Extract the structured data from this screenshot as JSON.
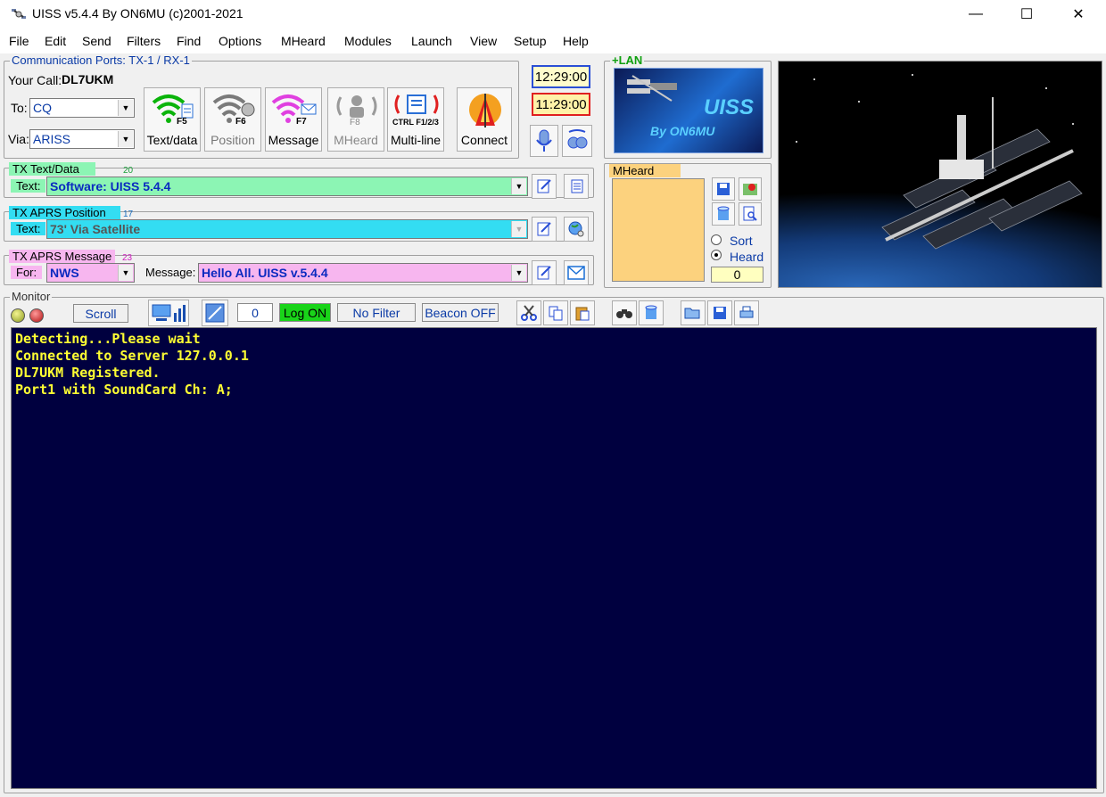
{
  "window": {
    "title": "UISS v5.4.4 By ON6MU (c)2001-2021",
    "minimize": "—",
    "maximize": "☐",
    "close": "✕"
  },
  "menu": [
    "File",
    "Edit",
    "Send",
    "Filters",
    "Find",
    "Options",
    "MHeard",
    "Modules",
    "Launch",
    "View",
    "Setup",
    "Help"
  ],
  "comm": {
    "group_title": "Communication Ports: TX-1 / RX-1",
    "your_call_label": "Your Call:",
    "your_call": "DL7UKM",
    "to_label": "To:",
    "to_value": "CQ",
    "via_label": "Via:",
    "via_value": "ARISS"
  },
  "buttons": {
    "text_data": {
      "label": "Text/data",
      "fkey": "F5"
    },
    "position": {
      "label": "Position",
      "fkey": "F6"
    },
    "message": {
      "label": "Message",
      "fkey": "F7"
    },
    "mheard": {
      "label": "MHeard",
      "fkey": "F8"
    },
    "multiline": {
      "label": "Multi-line",
      "fkey": "CTRL F1/2/3"
    },
    "connect": {
      "label": "Connect"
    }
  },
  "clocks": {
    "utc": "12:29:00",
    "local": "11:29:00"
  },
  "lan": {
    "label": "+LAN",
    "logo_title": "UISS",
    "logo_sub": "By ON6MU"
  },
  "tx_text": {
    "title": "TX Text/Data",
    "count": "20",
    "text_label": "Text:",
    "value": "Software: UISS 5.4.4"
  },
  "tx_pos": {
    "title": "TX APRS Position",
    "count": "17",
    "text_label": "Text:",
    "value": "73' Via Satellite"
  },
  "tx_msg": {
    "title": "TX APRS Message",
    "count": "23",
    "for_label": "For:",
    "for_value": "NWS",
    "message_label": "Message:",
    "message_value": "Hello All. UISS v.5.4.4"
  },
  "mheard_panel": {
    "title": "MHeard",
    "sort_label": "Sort",
    "heard_label": "Heard",
    "count": "0"
  },
  "monitor": {
    "title": "Monitor",
    "scroll": "Scroll",
    "counter": "0",
    "log": "Log ON",
    "filter": "No Filter",
    "beacon": "Beacon OFF",
    "lines": [
      "Detecting...Please wait",
      "Connected to Server 127.0.0.1",
      "DL7UKM Registered.",
      "Port1 with SoundCard Ch: A;"
    ]
  },
  "colors": {
    "tx_text": "#8cf5b4",
    "tx_pos": "#33ddf2",
    "tx_msg": "#f7b6ef",
    "mheard_bg": "#fcd27e",
    "console_bg": "#00003f",
    "console_fg": "#ffff33"
  }
}
